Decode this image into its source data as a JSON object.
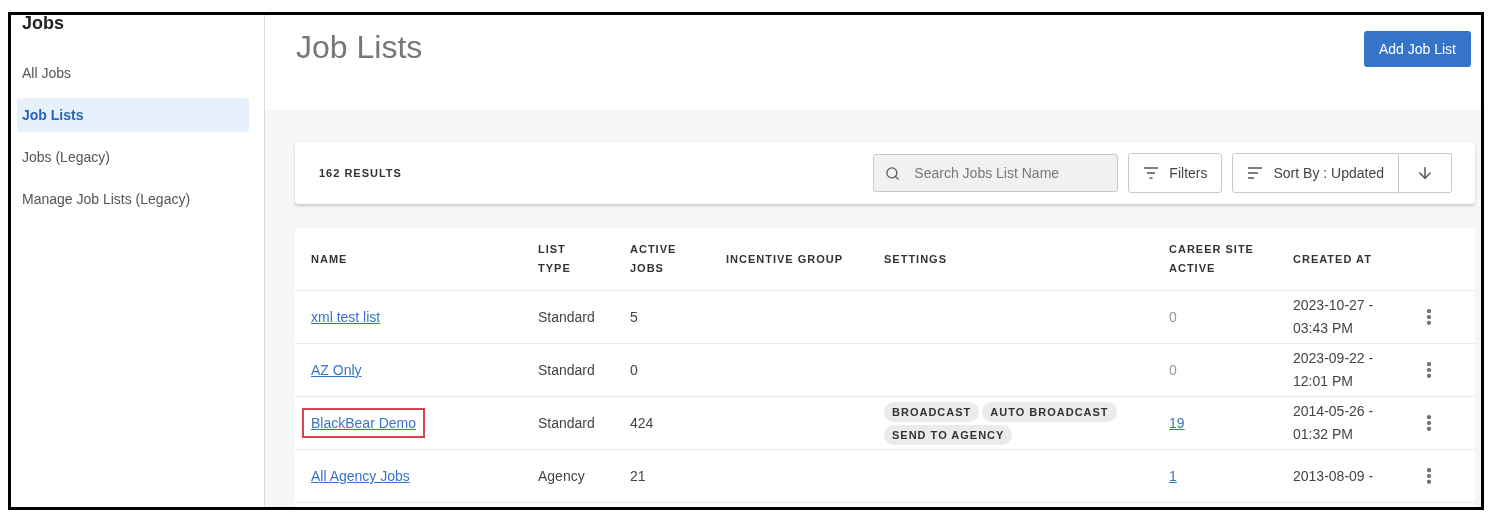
{
  "sidebar": {
    "title": "Jobs",
    "items": [
      {
        "label": "All Jobs",
        "selected": false
      },
      {
        "label": "Job Lists",
        "selected": true
      },
      {
        "label": "Jobs (Legacy)",
        "selected": false
      },
      {
        "label": "Manage Job Lists (Legacy)",
        "selected": false
      }
    ]
  },
  "page": {
    "title": "Job Lists",
    "add_button": "Add Job List"
  },
  "toolbar": {
    "results": "162 RESULTS",
    "search": {
      "placeholder": "Search Jobs List Name"
    },
    "filters": "Filters",
    "sort": "Sort By : Updated"
  },
  "table": {
    "columns": [
      "NAME",
      "LIST TYPE",
      "ACTIVE JOBS",
      "INCENTIVE GROUP",
      "SETTINGS",
      "CAREER SITE ACTIVE",
      "CREATED AT"
    ],
    "rows": [
      {
        "name": "xml test list",
        "highlighted": false,
        "list_type": "Standard",
        "active_jobs": "5",
        "settings": [],
        "career_site_active": "0",
        "career_site_linked": false,
        "created_at": "2023-10-27 - 03:43 PM"
      },
      {
        "name": "AZ Only",
        "highlighted": false,
        "list_type": "Standard",
        "active_jobs": "0",
        "settings": [],
        "career_site_active": "0",
        "career_site_linked": false,
        "created_at": "2023-09-22 - 12:01 PM"
      },
      {
        "name": "BlackBear Demo",
        "highlighted": true,
        "list_type": "Standard",
        "active_jobs": "424",
        "settings": [
          "BROADCAST",
          "AUTO BROADCAST",
          "SEND TO AGENCY"
        ],
        "career_site_active": "19",
        "career_site_linked": true,
        "created_at": "2014-05-26 - 01:32 PM"
      },
      {
        "name": "All Agency Jobs",
        "highlighted": false,
        "list_type": "Agency",
        "active_jobs": "21",
        "settings": [],
        "career_site_active": "1",
        "career_site_linked": true,
        "created_at": "2013-08-09 -"
      }
    ]
  }
}
